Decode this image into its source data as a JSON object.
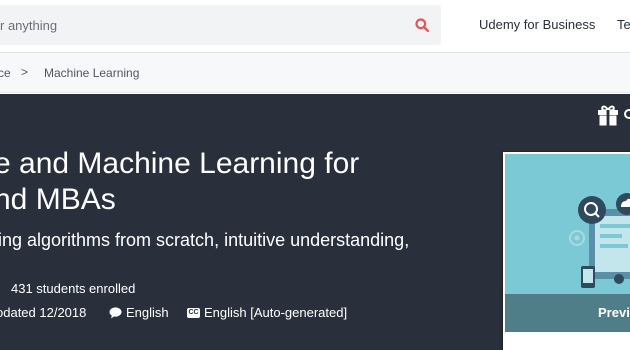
{
  "header": {
    "search_placeholder": "r anything",
    "nav": {
      "business": "Udemy for Business",
      "teach": "Te"
    }
  },
  "breadcrumb": {
    "parent": "ce",
    "separator": ">",
    "current": "Machine Learning"
  },
  "course": {
    "title_line1": "e and Machine Learning for",
    "title_line2": "nd MBAs",
    "subtitle": "ing algorithms from scratch, intuitive understanding,",
    "enrolled": "431 students enrolled",
    "updated": "odated 12/2018",
    "language": "English",
    "captions_badge": "CC",
    "captions": "English [Auto-generated]"
  },
  "preview": {
    "label": "Previ"
  },
  "colors": {
    "hero_bg": "#29303b",
    "search_icon": "#ec5252",
    "preview_bg": "#7bc9d5"
  },
  "icons": {
    "search": "search-icon",
    "gift": "gift-icon",
    "speech_bubble": "speech-bubble-icon",
    "closed_captions": "closed-captions-icon"
  }
}
